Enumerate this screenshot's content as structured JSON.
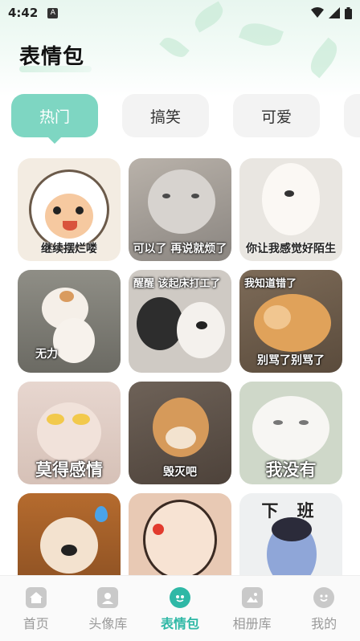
{
  "status_bar": {
    "time": "4:42",
    "badge": "A"
  },
  "header": {
    "title": "表情包"
  },
  "tabs": [
    {
      "label": "热门",
      "active": true
    },
    {
      "label": "搞笑",
      "active": false
    },
    {
      "label": "可爱",
      "active": false
    }
  ],
  "stickers": [
    {
      "caption": "继续摆烂喽"
    },
    {
      "caption": "可以了 再说就烦了"
    },
    {
      "caption": "你让我感觉好陌生"
    },
    {
      "caption": "无力"
    },
    {
      "caption": "醒醒 该起床打工了"
    },
    {
      "caption": "别骂了别骂了",
      "overlay": "我知道错了"
    },
    {
      "caption": "莫得感情"
    },
    {
      "caption": "毁灭吧"
    },
    {
      "caption": "我没有"
    },
    {
      "caption": ""
    },
    {
      "caption": ""
    },
    {
      "caption": "下  班"
    }
  ],
  "bottom_nav": [
    {
      "label": "首页",
      "icon": "home-icon",
      "active": false
    },
    {
      "label": "头像库",
      "icon": "avatar-icon",
      "active": false
    },
    {
      "label": "表情包",
      "icon": "emoji-pack-icon",
      "active": true
    },
    {
      "label": "相册库",
      "icon": "album-icon",
      "active": false
    },
    {
      "label": "我的",
      "icon": "smile-icon",
      "active": false
    }
  ],
  "colors": {
    "accent": "#2fb8a6",
    "tab_active": "#7ed6c2"
  }
}
